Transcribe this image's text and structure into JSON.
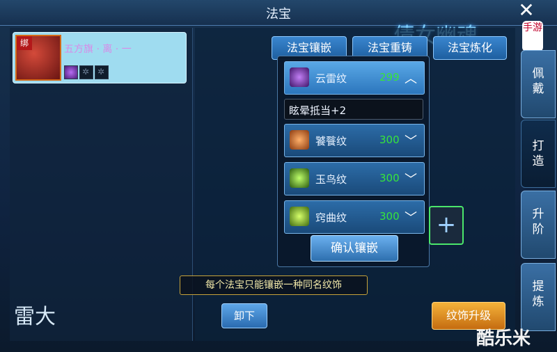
{
  "window": {
    "title": "法宝",
    "close_glyph": "✕"
  },
  "logo": {
    "text": "倩女幽魂",
    "tag": "手游"
  },
  "item": {
    "bound_label": "绑",
    "name": "五方旗 · 离 · 一",
    "slot_glyph": "✲"
  },
  "tabs": [
    "法宝镶嵌",
    "法宝重铸",
    "法宝炼化"
  ],
  "side_tabs": [
    {
      "label": "佩戴",
      "active": false
    },
    {
      "label": "打造",
      "active": true
    },
    {
      "label": "升阶",
      "active": false
    },
    {
      "label": "提炼",
      "active": false
    }
  ],
  "dropdown": {
    "selected_effect": "眩晕抵当+2",
    "options": [
      {
        "label": "云雷纹",
        "cost": "299",
        "expanded": true
      },
      {
        "label": "饕餮纹",
        "cost": "300",
        "expanded": false
      },
      {
        "label": "玉鸟纹",
        "cost": "300",
        "expanded": false
      },
      {
        "label": "窍曲纹",
        "cost": "300",
        "expanded": false
      }
    ]
  },
  "buttons": {
    "confirm": "确认镶嵌",
    "unload": "卸下",
    "upgrade": "纹饰升级",
    "add_glyph": "+"
  },
  "hint": "每个法宝只能镶嵌一种同名纹饰",
  "corner_logo": "雷大",
  "watermark": "酷乐米",
  "colors": {
    "cost_green": "#36e53c",
    "item_name_pink": "#d78be8",
    "accent_blue": "#2c76bd"
  }
}
